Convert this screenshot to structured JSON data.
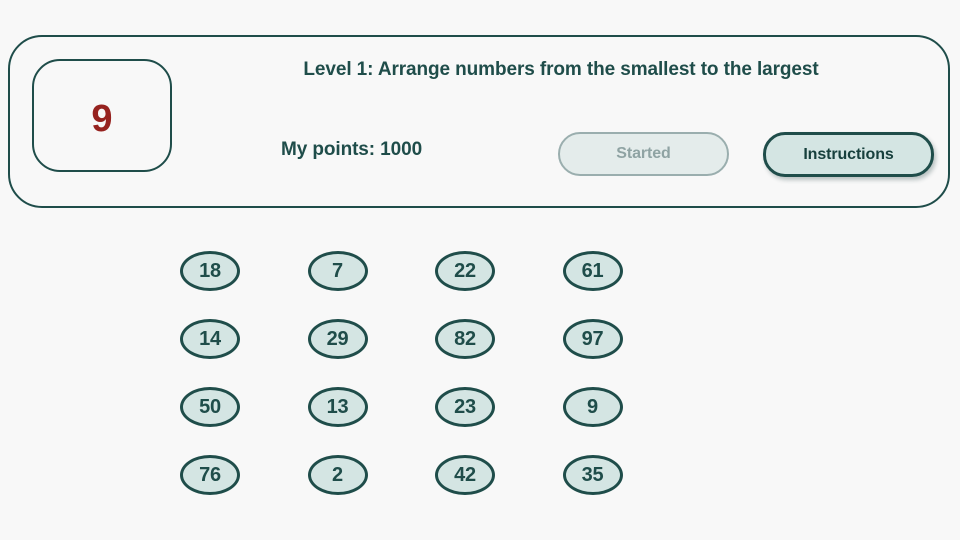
{
  "page": {
    "background_color": "#f8f8f8",
    "accent_color": "#1f4d4a",
    "bubble_fill_color": "#d4e5e3",
    "current_number_color": "#96221f",
    "disabled_color": "#8fa3a3"
  },
  "header": {
    "current_number": "9",
    "title": "Level 1: Arrange numbers from the smallest to the largest",
    "points_label": "My points: 1000",
    "started_button_label": "Started",
    "instructions_button_label": "Instructions"
  },
  "grid": {
    "rows": [
      [
        "18",
        "7",
        "22",
        "61"
      ],
      [
        "14",
        "29",
        "82",
        "97"
      ],
      [
        "50",
        "13",
        "23",
        "9"
      ],
      [
        "76",
        "2",
        "42",
        "35"
      ]
    ]
  }
}
